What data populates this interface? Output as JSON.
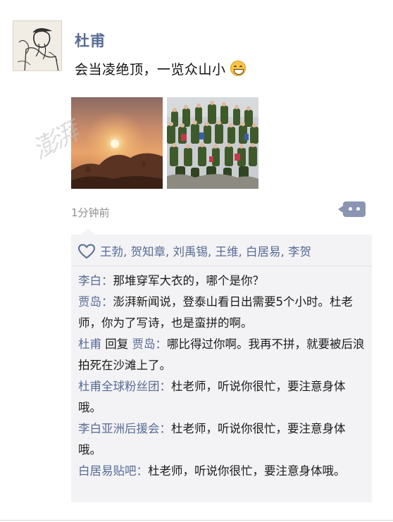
{
  "post": {
    "author": "杜甫",
    "text": "会当凌绝顶，一览众山小",
    "emoji": "grin-emoji",
    "watermark": "澎湃",
    "time": "1分钟前"
  },
  "likes": {
    "icon": "heart-outline-icon",
    "names": "王勃, 贺知章, 刘禹锡, 王维, 白居易, 李贺"
  },
  "comments": [
    {
      "name": "李白",
      "sep": "：",
      "text": "那堆穿军大衣的，哪个是你？"
    },
    {
      "name": "贾岛",
      "sep": "：",
      "text": "澎湃新闻说，登泰山看日出需要5个小时。杜老师，你为了写诗，也是蛮拼的啊。"
    },
    {
      "name": "杜甫",
      "reply_word": " 回复 ",
      "reply_to": "贾岛",
      "sep": "：",
      "text": "哪比得过你啊。我再不拼，就要被后浪拍死在沙滩上了。"
    },
    {
      "name": "杜甫全球粉丝团",
      "sep": "：",
      "text": "杜老师，听说你很忙，要注意身体哦。"
    },
    {
      "name": "李白亚洲后援会",
      "sep": "：",
      "text": "杜老师，听说你很忙，要注意身体哦。"
    },
    {
      "name": "白居易贴吧",
      "sep": "：",
      "text": "杜老师，听说你很忙，要注意身体哦。"
    }
  ],
  "colors": {
    "link": "#576b95",
    "comment_bg": "#f3f3f5",
    "timestamp": "#8f8f8f",
    "action_button": "#8a95b4"
  }
}
